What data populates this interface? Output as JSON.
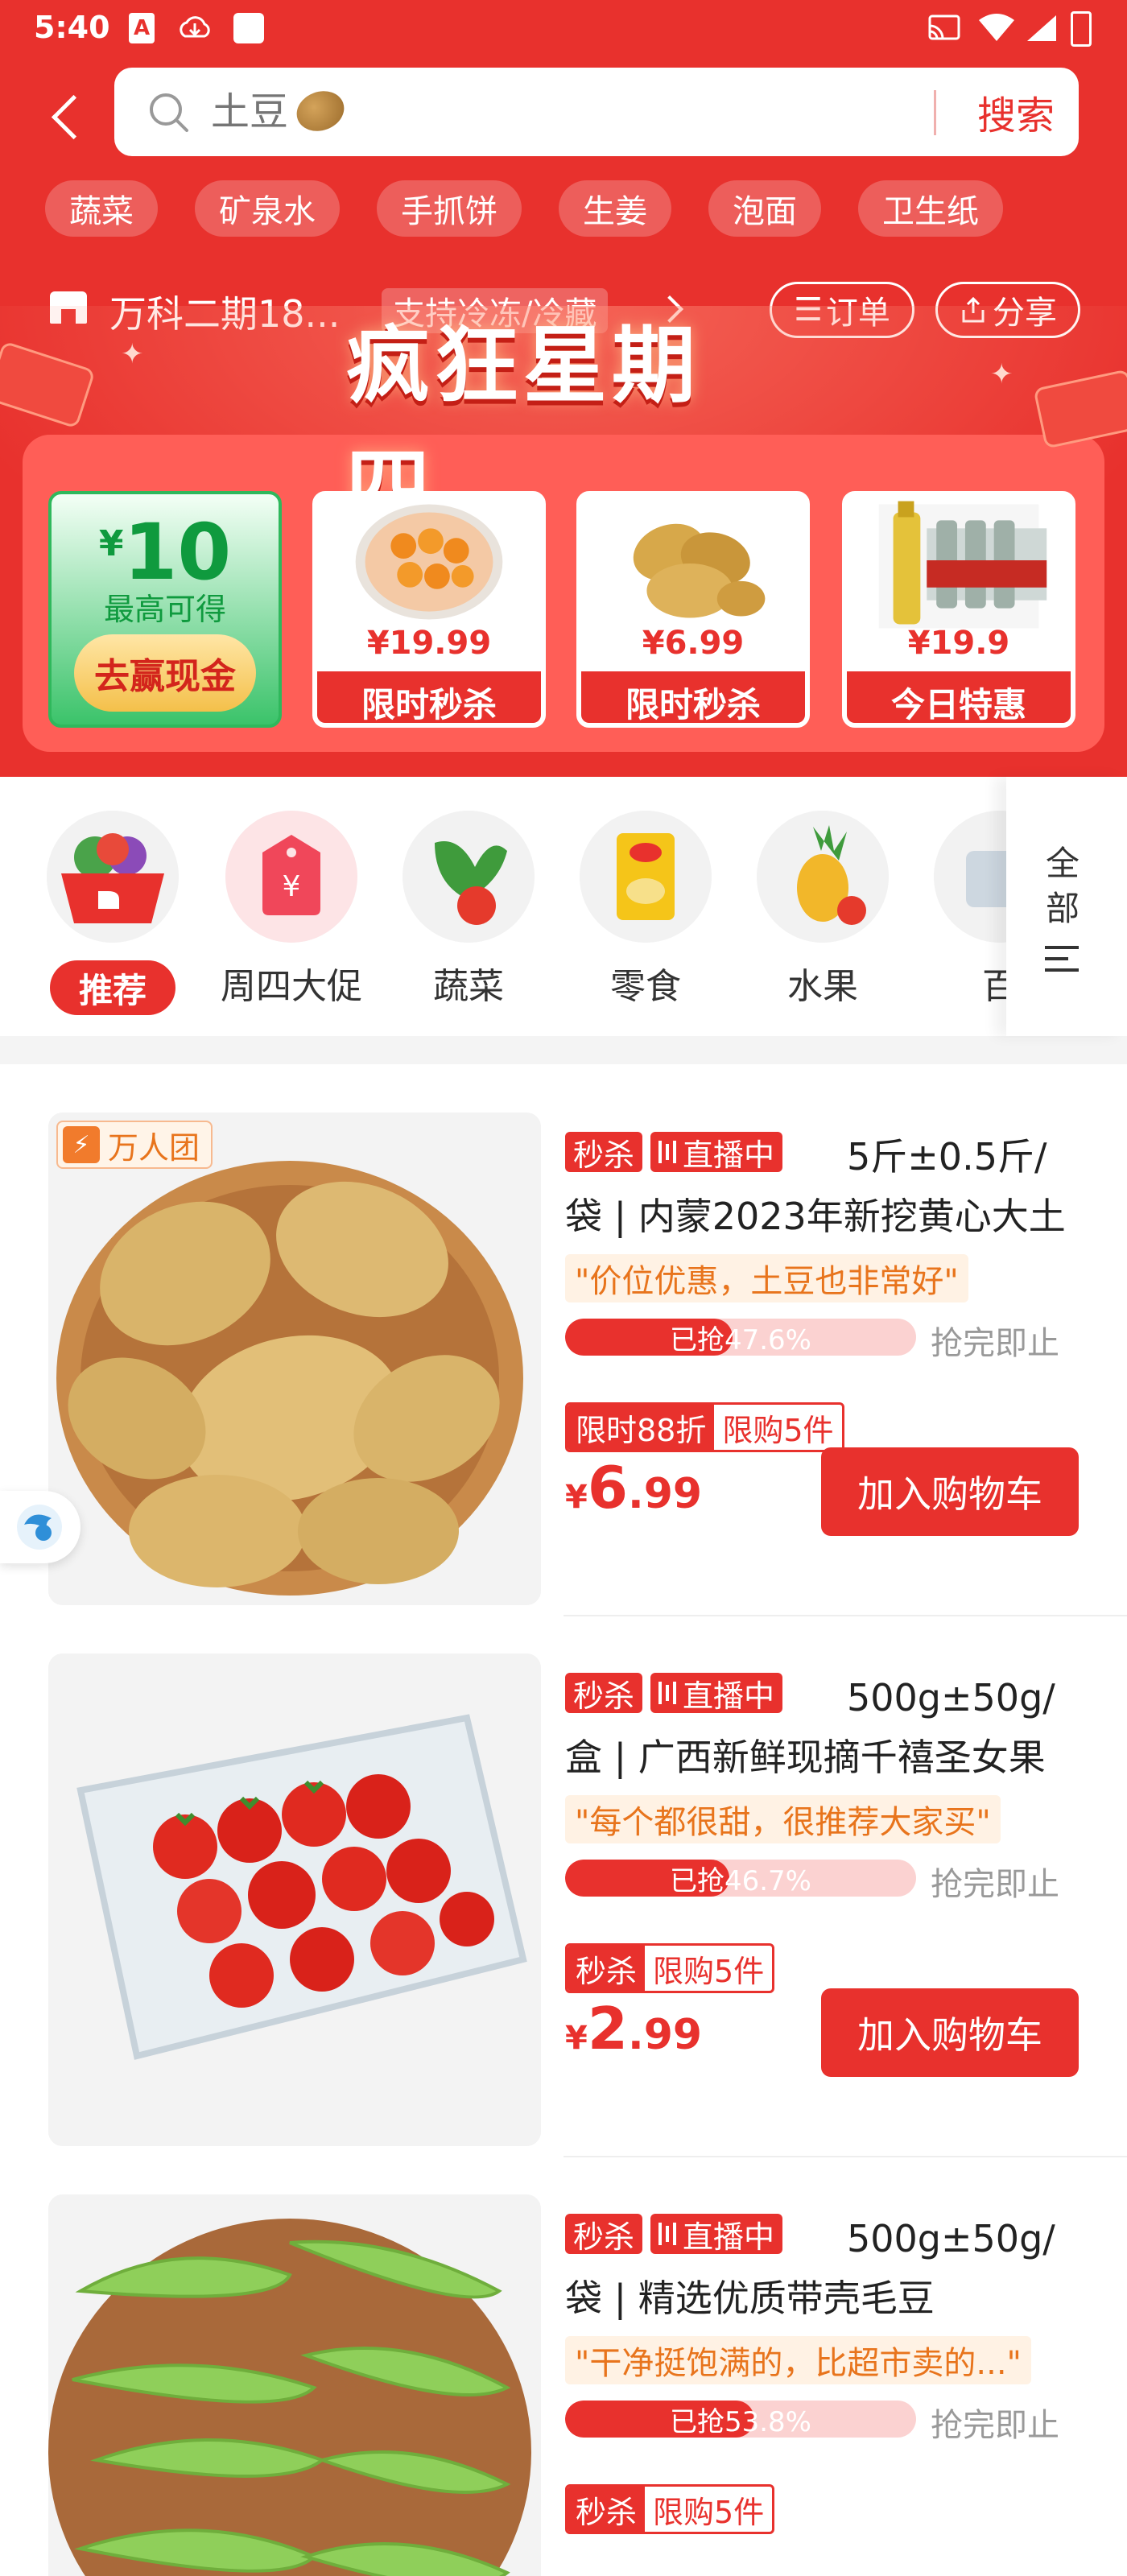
{
  "status_bar": {
    "time": "5:40"
  },
  "search": {
    "placeholder": "土豆",
    "button_label": "搜索"
  },
  "quick_tags": [
    "蔬菜",
    "矿泉水",
    "手抓饼",
    "生姜",
    "泡面",
    "卫生纸"
  ],
  "store": {
    "name": "万科二期18...",
    "badge": "支持冷冻/冷藏",
    "orders_label": "订单",
    "share_label": "分享"
  },
  "promo": {
    "title": "疯狂星期四",
    "cash": {
      "yen": "¥",
      "amount": "10",
      "subtitle": "最高可得",
      "button": "去赢现金"
    },
    "deals": [
      {
        "price": "¥19.99",
        "label": "限时秒杀",
        "icon": "eggs-image"
      },
      {
        "price": "¥6.99",
        "label": "限时秒杀",
        "icon": "potato-image"
      },
      {
        "price": "¥19.9",
        "label": "今日特惠",
        "icon": "beer-bottles-image"
      }
    ]
  },
  "categories": [
    {
      "label": "推荐",
      "active": true
    },
    {
      "label": "周四大促",
      "active": false
    },
    {
      "label": "蔬菜",
      "active": false
    },
    {
      "label": "零食",
      "active": false
    },
    {
      "label": "水果",
      "active": false
    },
    {
      "label": "百",
      "active": false
    }
  ],
  "category_all": "全部",
  "products": [
    {
      "group_badge": "万人团",
      "tag_flash": "秒杀",
      "tag_live": "直播中",
      "title": "5斤±0.5斤/袋 | 内蒙2023年新挖黄心大土",
      "quote": "\"价位优惠，土豆也非常好\"",
      "progress_label": "已抢47.6%",
      "progress": 0.476,
      "end_text": "抢完即止",
      "limit_a": "限时88折",
      "limit_b": "限购5件",
      "price_yen": "¥",
      "price_int": "6",
      "price_dec": ".99",
      "cart_label": "加入购物车"
    },
    {
      "tag_flash": "秒杀",
      "tag_live": "直播中",
      "title": "500g±50g/盒 | 广西新鲜现摘千禧圣女果",
      "quote": "\"每个都很甜，很推荐大家买\"",
      "progress_label": "已抢46.7%",
      "progress": 0.467,
      "end_text": "抢完即止",
      "limit_a": "秒杀",
      "limit_b": "限购5件",
      "price_yen": "¥",
      "price_int": "2",
      "price_dec": ".99",
      "cart_label": "加入购物车"
    },
    {
      "tag_flash": "秒杀",
      "tag_live": "直播中",
      "title": "500g±50g/袋 | 精选优质带壳毛豆",
      "quote": "\"干净挺饱满的，比超市卖的...\"",
      "progress_label": "已抢53.8%",
      "progress": 0.538,
      "end_text": "抢完即止",
      "limit_a": "秒杀",
      "limit_b": "限购5件"
    }
  ],
  "colors": {
    "brand_red": "#e8312d",
    "progress_bg": "#fbd2d1",
    "quote_orange": "#e8741c"
  }
}
